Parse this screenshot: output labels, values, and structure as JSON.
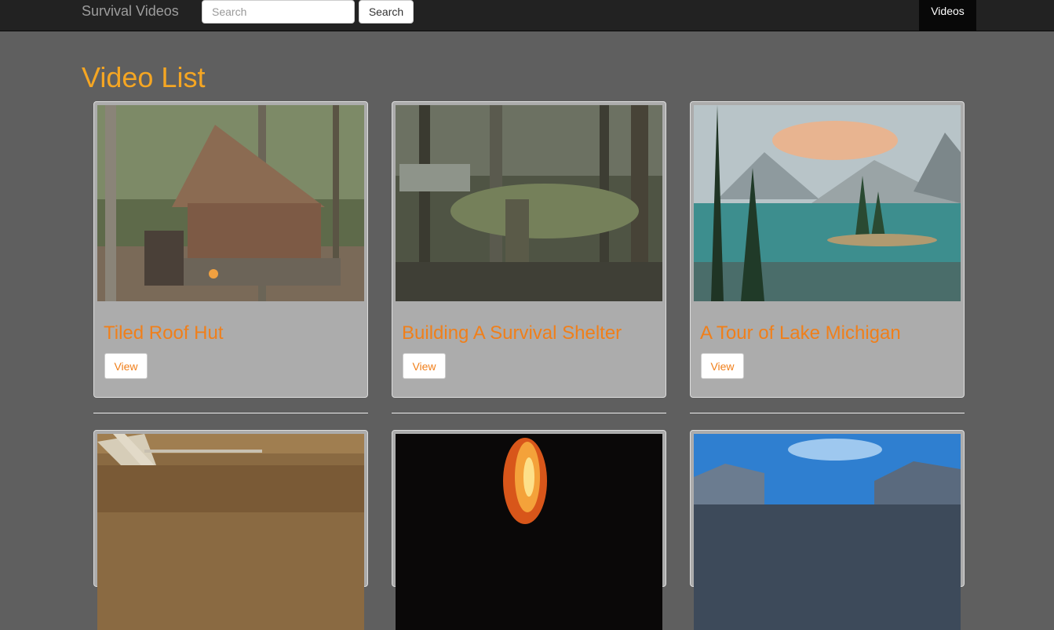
{
  "navbar": {
    "brand": "Survival Videos",
    "search_placeholder": "Search",
    "search_button": "Search",
    "nav_item": "Videos"
  },
  "main": {
    "title": "Video List",
    "view_label": "View",
    "videos": [
      {
        "title": "Tiled Roof Hut",
        "image": "hut-thumbnail"
      },
      {
        "title": "Building A Survival Shelter",
        "image": "shelter-thumbnail"
      },
      {
        "title": "A Tour of Lake Michigan",
        "image": "lake-thumbnail"
      },
      {
        "title": "",
        "image": "forest-floor-thumbnail"
      },
      {
        "title": "",
        "image": "campfire-thumbnail"
      },
      {
        "title": "",
        "image": "mountain-valley-thumbnail"
      }
    ]
  },
  "colors": {
    "background": "#5f5f5f",
    "navbar": "#222222",
    "accent": "#f5a623",
    "card_title": "#f07f1a",
    "card": "#acacac"
  }
}
